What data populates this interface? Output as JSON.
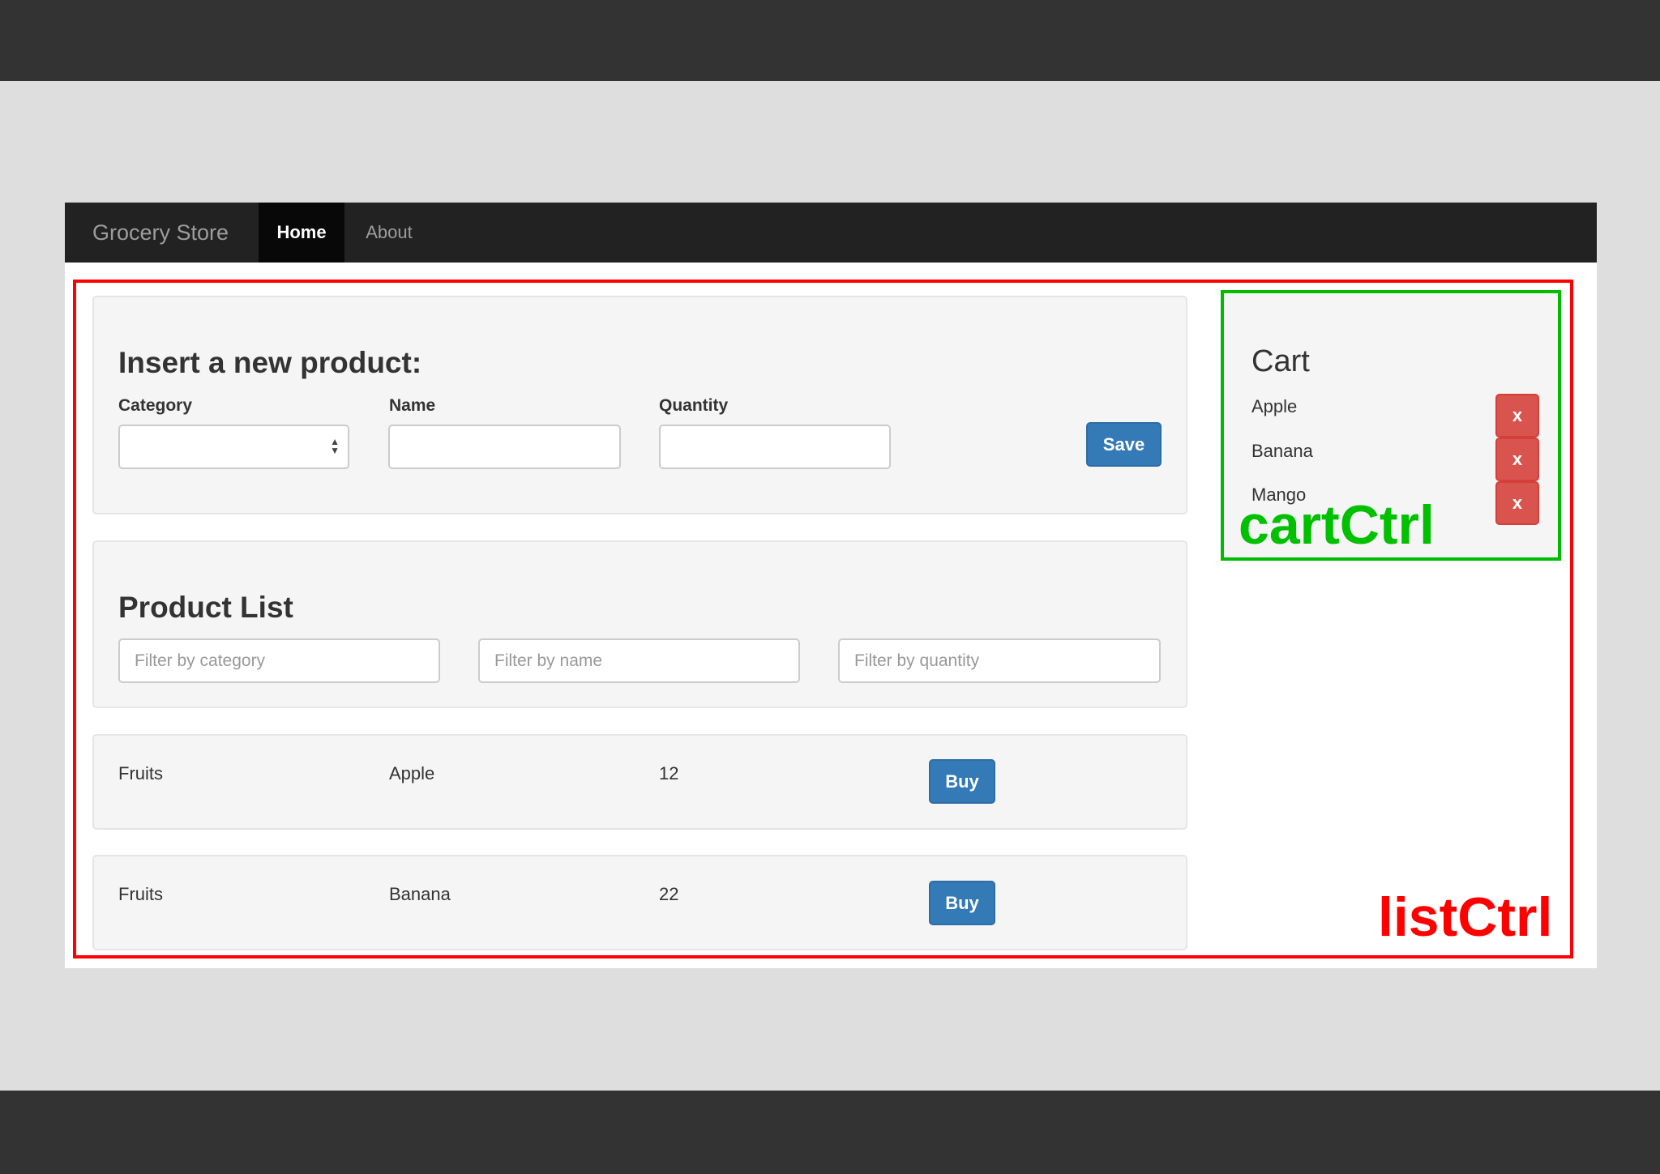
{
  "navbar": {
    "brand": "Grocery Store",
    "items": [
      {
        "label": "Home",
        "active": true
      },
      {
        "label": "About",
        "active": false
      }
    ]
  },
  "insert_form": {
    "title": "Insert a new product:",
    "category_label": "Category",
    "category_value": "",
    "name_label": "Name",
    "name_value": "",
    "quantity_label": "Quantity",
    "quantity_value": "",
    "save_label": "Save"
  },
  "product_list": {
    "title": "Product List",
    "filters": {
      "category_placeholder": "Filter by category",
      "name_placeholder": "Filter by name",
      "quantity_placeholder": "Filter by quantity"
    },
    "rows": [
      {
        "category": "Fruits",
        "name": "Apple",
        "quantity": "12",
        "buy_label": "Buy"
      },
      {
        "category": "Fruits",
        "name": "Banana",
        "quantity": "22",
        "buy_label": "Buy"
      }
    ]
  },
  "cart": {
    "title": "Cart",
    "items": [
      {
        "name": "Apple",
        "remove_label": "x"
      },
      {
        "name": "Banana",
        "remove_label": "x"
      },
      {
        "name": "Mango",
        "remove_label": "x"
      }
    ]
  },
  "annotations": {
    "cart_controller": "cartCtrl",
    "list_controller": "listCtrl",
    "cart_color": "#00bb00",
    "list_color": "#ff0000"
  },
  "colors": {
    "primary": "#337ab7",
    "danger": "#d9534f",
    "navbar": "#222222"
  }
}
